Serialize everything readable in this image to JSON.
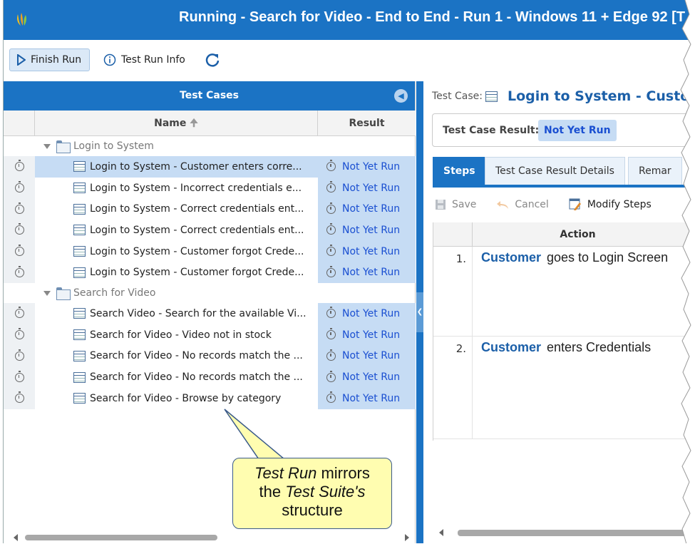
{
  "window": {
    "title": "Running - Search for Video - End to End - Run 1 - Windows 11 + Edge 92 [T"
  },
  "toolbar": {
    "finish_run": "Finish Run",
    "test_run_info": "Test Run Info",
    "refresh_icon": "refresh-icon"
  },
  "left_panel": {
    "header": "Test Cases",
    "columns": {
      "name": "Name",
      "result": "Result"
    },
    "groups": [
      {
        "label": "Login to System",
        "cases": [
          {
            "name": "Login to System - Customer enters corre...",
            "result": "Not Yet Run",
            "selected": true
          },
          {
            "name": "Login to System - Incorrect credentials e...",
            "result": "Not Yet Run"
          },
          {
            "name": "Login to System - Correct credentials ent...",
            "result": "Not Yet Run"
          },
          {
            "name": "Login to System - Correct credentials ent...",
            "result": "Not Yet Run"
          },
          {
            "name": "Login to System - Customer forgot Crede...",
            "result": "Not Yet Run"
          },
          {
            "name": "Login to System - Customer forgot Crede...",
            "result": "Not Yet Run"
          }
        ]
      },
      {
        "label": "Search for Video",
        "cases": [
          {
            "name": "Search Video - Search for the available Vi...",
            "result": "Not Yet Run"
          },
          {
            "name": "Search for Video - Video not in stock",
            "result": "Not Yet Run"
          },
          {
            "name": "Search for Video - No records match the ...",
            "result": "Not Yet Run"
          },
          {
            "name": "Search for Video - No records match the ...",
            "result": "Not Yet Run"
          },
          {
            "name": "Search for Video - Browse by category",
            "result": "Not Yet Run"
          }
        ]
      }
    ]
  },
  "callout": {
    "line1_em": "Test Run",
    "line1_rest": " mirrors",
    "line2_pre": "the ",
    "line2_em": "Test Suite's",
    "line3": "structure"
  },
  "right_panel": {
    "test_case_label": "Test Case:",
    "test_case_name": "Login to System - Custom",
    "result_label": "Test Case Result:",
    "result_value": "Not Yet Run",
    "tabs": [
      "Steps",
      "Test Case Result Details",
      "Remar"
    ],
    "actions": {
      "save": "Save",
      "cancel": "Cancel",
      "modify_steps": "Modify Steps"
    },
    "grid_header": "Action",
    "steps": [
      {
        "num": "1.",
        "actor": "Customer",
        "text": "goes to Login Screen"
      },
      {
        "num": "2.",
        "actor": "Customer",
        "text": "enters Credentials"
      }
    ]
  },
  "colors": {
    "brand_blue": "#1b73c4",
    "selection": "#c6dcf4",
    "result_text": "#1a4fd1",
    "callout_bg": "#fffdb0"
  }
}
